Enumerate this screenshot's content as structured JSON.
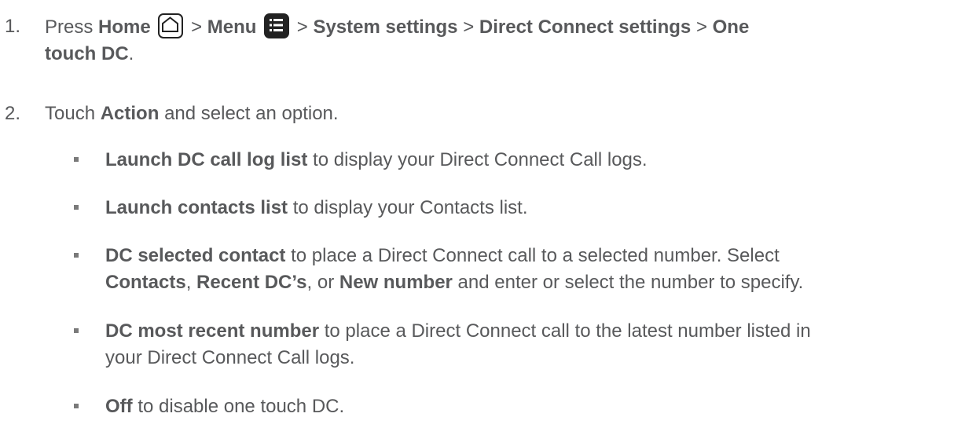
{
  "steps": [
    {
      "number": "1.",
      "press": "Press",
      "home": "Home",
      "sep1": ">",
      "menu": "Menu",
      "sep2": ">",
      "system_settings": "System settings",
      "sep3": ">",
      "dc_settings": "Direct Connect settings",
      "sep4": ">",
      "one": "One",
      "touch_dc": "touch DC",
      "period": "."
    },
    {
      "number": "2.",
      "touch": "Touch",
      "action": "Action",
      "rest": "and select an option."
    }
  ],
  "icons": {
    "home": "home-icon",
    "menu": "menu-icon"
  },
  "options": [
    {
      "title": "Launch DC call log list",
      "text": " to display your Direct Connect Call logs."
    },
    {
      "title": "Launch contacts list",
      "text": " to display your Contacts list."
    },
    {
      "title": "DC selected contact",
      "text_a": " to place a Direct Connect call to a selected number. Select",
      "contacts": "Contacts",
      "comma1": ", ",
      "recent": "Recent DC’s",
      "or": ", or ",
      "new_number": "New number",
      "text_b": " and enter or select the number to specify."
    },
    {
      "title": "DC most recent number",
      "text_a": " to place a Direct Connect call to the latest number listed in",
      "text_b": "your Direct Connect Call logs."
    },
    {
      "title": "Off",
      "text": " to disable one touch DC."
    }
  ]
}
